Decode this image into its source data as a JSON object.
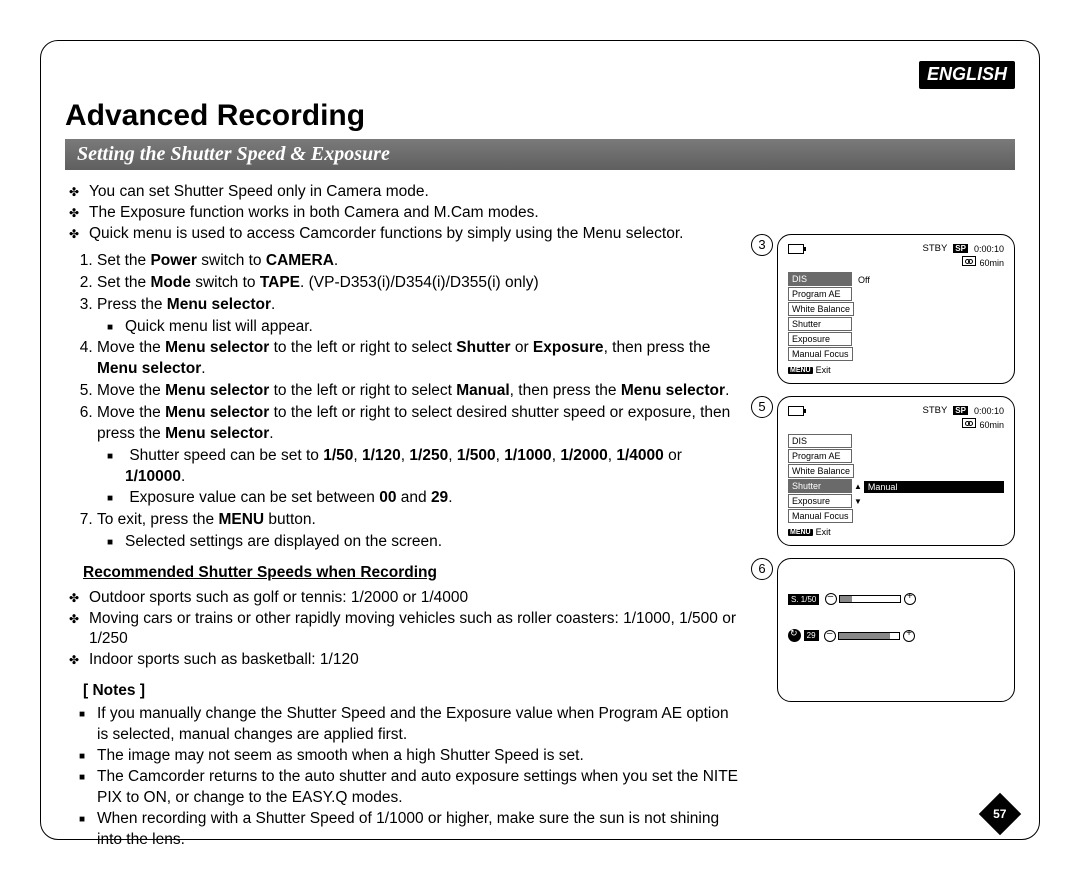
{
  "language_badge": "ENGLISH",
  "page_title": "Advanced Recording",
  "section_title": "Setting the Shutter Speed & Exposure",
  "page_number": "57",
  "intro_bullets": [
    "You can set Shutter Speed only in Camera mode.",
    "The Exposure function works in both Camera and M.Cam modes.",
    "Quick menu is used to access Camcorder functions by simply using the Menu selector."
  ],
  "steps": {
    "s1": {
      "pre": "Set the ",
      "b1": "Power",
      "mid": " switch to ",
      "b2": "CAMERA",
      "post": "."
    },
    "s2": {
      "pre": "Set the ",
      "b1": "Mode",
      "mid": " switch to ",
      "b2": "TAPE",
      "post": ". (VP-D353(i)/D354(i)/D355(i) only)"
    },
    "s3": {
      "pre": "Press the ",
      "b1": "Menu selector",
      "post": ".",
      "sub": "Quick menu list will appear."
    },
    "s4": {
      "pre": "Move the ",
      "b1": "Menu selector",
      "mid": " to the left or right to select ",
      "b2": "Shutter",
      "mid2": " or ",
      "b3": "Exposure",
      "mid3": ", then press the ",
      "b4": "Menu selector",
      "post": "."
    },
    "s5": {
      "pre": "Move the ",
      "b1": "Menu selector",
      "mid": " to the left or right to select ",
      "b2": "Manual",
      "mid2": ", then press the ",
      "b3": "Menu selector",
      "post": "."
    },
    "s6": {
      "pre": "Move the ",
      "b1": "Menu selector",
      "mid": " to the left or right to select desired shutter speed or exposure, then press the ",
      "b2": "Menu selector",
      "post": ".",
      "sub1a": "Shutter speed can be set to ",
      "ss": "1/50, 1/120, 1/250, 1/500, 1/1000, 1/2000, 1/4000",
      "sub1b": " or ",
      "ss2": "1/10000",
      "sub1c": ".",
      "sub2a": "Exposure value can be set between ",
      "e1": "00",
      "sub2b": " and ",
      "e2": "29",
      "sub2c": "."
    },
    "s7": {
      "pre": "To exit, press the ",
      "b1": "MENU",
      "post": " button.",
      "sub": "Selected settings are displayed on the screen."
    }
  },
  "recommended_heading": "Recommended Shutter Speeds when Recording",
  "recommended": [
    "Outdoor sports such as golf or tennis: 1/2000 or 1/4000",
    "Moving cars or trains or other rapidly moving vehicles such as roller coasters: 1/1000, 1/500 or 1/250",
    "Indoor sports such as basketball: 1/120"
  ],
  "notes_heading": "[ Notes ]",
  "notes": [
    "If you manually change the Shutter Speed and the Exposure value when Program AE option is selected, manual changes are applied first.",
    "The image may not seem as smooth when a high Shutter Speed is set.",
    "The Camcorder returns to the auto shutter and auto exposure settings when you set the NITE PIX to ON, or change to the EASY.Q modes.",
    "When recording with a Shutter Speed of 1/1000 or higher, make sure the sun is not shining into the lens."
  ],
  "lcd_common": {
    "stby": "STBY",
    "sp": "SP",
    "timecode": "0:00:10",
    "remain": "60min",
    "menu_btn": "MENU",
    "exit": "Exit"
  },
  "lcd3": {
    "step": "3",
    "items": [
      "DIS",
      "Program AE",
      "White Balance",
      "Shutter",
      "Exposure",
      "Manual Focus"
    ],
    "dis_value": "Off"
  },
  "lcd5": {
    "step": "5",
    "items": [
      "DIS",
      "Program AE",
      "White Balance",
      "Shutter",
      "Exposure",
      "Manual Focus"
    ],
    "highlight_index": 3,
    "highlight_value": "Manual"
  },
  "lcd6": {
    "step": "6",
    "shutter_label": "S. 1/50",
    "exposure_label": "29"
  }
}
